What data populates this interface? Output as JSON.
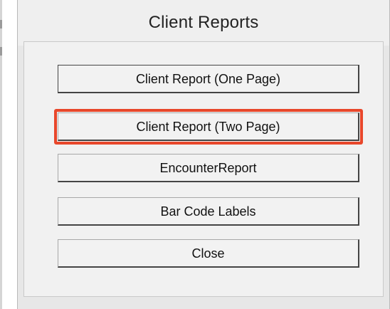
{
  "dialog": {
    "title": "Client Reports"
  },
  "buttons": {
    "one_page": "Client Report (One Page)",
    "two_page": "Client Report (Two Page)",
    "encounter": "EncounterReport",
    "bar_code": "Bar Code Labels",
    "close": "Close"
  },
  "colors": {
    "highlight": "#e8472b",
    "dialog_bg": "#e7e7e7",
    "panel_bg": "#f1f1f1",
    "button_bg": "#f2f2f2"
  }
}
